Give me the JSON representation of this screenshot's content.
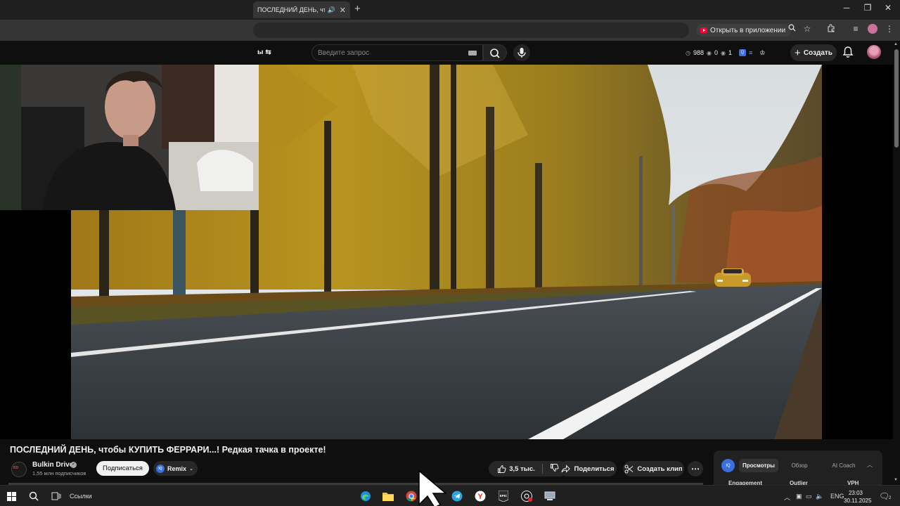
{
  "browser": {
    "tab_title": "ПОСЛЕДНИЙ ДЕНЬ, чтобы",
    "open_in_app_label": "Открыть в приложении"
  },
  "masthead": {
    "chip_fragment": "ы",
    "search_placeholder": "Введите запрос",
    "stats": {
      "views": "988",
      "likes": "0",
      "watching": "1"
    },
    "create_label": "Создать"
  },
  "video": {
    "title": "ПОСЛЕДНИЙ ДЕНЬ, чтобы КУПИТЬ ФЕРРАРИ...! Редкая тачка в проекте!",
    "channel_name": "Bulkin Drive",
    "subscribers": "1,55 млн подписчиков",
    "subscribe_label": "Подписаться",
    "remix_label": "Remix",
    "likes": "3,5 тыс.",
    "share_label": "Поделиться",
    "clip_label": "Создать клип"
  },
  "analytics_panel": {
    "logo": "IQ",
    "tabs": [
      "Просмотры",
      "Обзор",
      "AI Coach"
    ],
    "active_tab": "Просмотры",
    "columns": [
      "Engagement",
      "Outlier",
      "VPH"
    ]
  },
  "taskbar": {
    "links_label": "Ссылки",
    "language": "ENG",
    "time": "23:03",
    "date": "30.11.2025",
    "notification_count": "2"
  },
  "icons": {
    "tab_audio": "speaker-icon",
    "search": "search-icon",
    "mic": "microphone-icon",
    "bell": "bell-icon",
    "verified": "verified-check-icon",
    "like": "thumbs-up-icon",
    "dislike": "thumbs-down-icon",
    "share": "share-arrow-icon",
    "clip": "scissors-icon"
  },
  "colors": {
    "page_bg": "#0f0f0f",
    "accent_red": "#ff0033",
    "accent_blue": "#3b6fe0",
    "chrome_toolbar": "#353535"
  }
}
